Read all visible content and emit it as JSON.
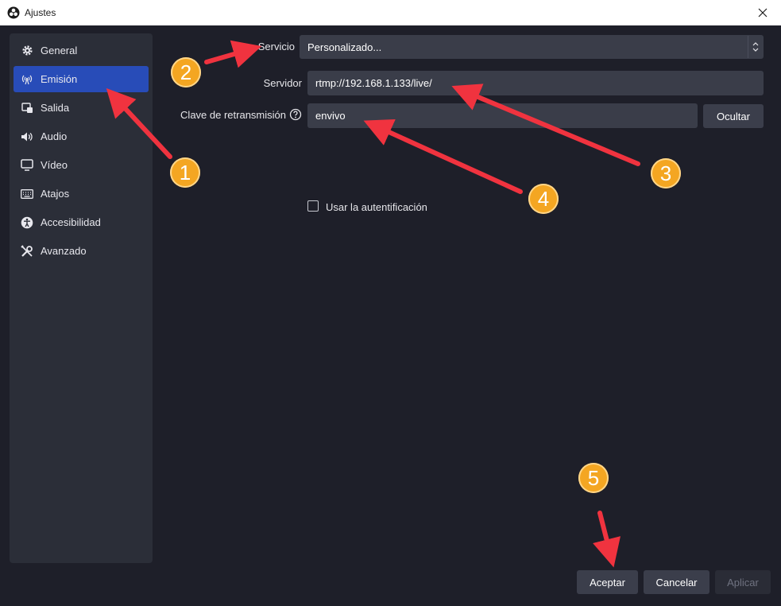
{
  "window": {
    "title": "Ajustes"
  },
  "sidebar": {
    "items": [
      {
        "label": "General",
        "icon": "gear-icon"
      },
      {
        "label": "Emisión",
        "icon": "antenna-icon",
        "active": true
      },
      {
        "label": "Salida",
        "icon": "output-icon"
      },
      {
        "label": "Audio",
        "icon": "speaker-icon"
      },
      {
        "label": "Vídeo",
        "icon": "monitor-icon"
      },
      {
        "label": "Atajos",
        "icon": "keyboard-icon"
      },
      {
        "label": "Accesibilidad",
        "icon": "accessibility-icon"
      },
      {
        "label": "Avanzado",
        "icon": "tools-icon"
      }
    ]
  },
  "stream": {
    "service_label": "Servicio",
    "service_value": "Personalizado...",
    "server_label": "Servidor",
    "server_value": "rtmp://192.168.1.133/live/",
    "key_label": "Clave de retransmisión",
    "key_value": "envivo",
    "hide_button": "Ocultar",
    "auth_label": "Usar la autentificación",
    "auth_checked": false
  },
  "footer": {
    "ok": "Aceptar",
    "cancel": "Cancelar",
    "apply": "Aplicar"
  },
  "annotations": [
    "1",
    "2",
    "3",
    "4",
    "5"
  ],
  "colors": {
    "accent": "#284cb8",
    "badge": "#f4a622",
    "arrow": "#f0333f",
    "background": "#1e1f29"
  }
}
